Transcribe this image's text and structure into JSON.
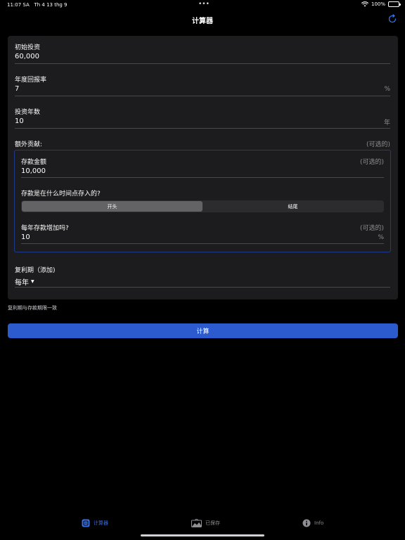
{
  "status": {
    "time": "11:07 SA",
    "date": "Th 4 13 thg 9",
    "dots": "•••",
    "battery": "100%"
  },
  "nav": {
    "title": "计算器",
    "refresh_icon": "refresh-icon"
  },
  "form": {
    "initial": {
      "label": "初始投资",
      "value": "60,000"
    },
    "rate": {
      "label": "年度回报率",
      "value": "7",
      "unit": "%"
    },
    "years": {
      "label": "投资年数",
      "value": "10",
      "unit": "年"
    },
    "extra": {
      "label": "额外贡献:",
      "optional": "(可选的)",
      "deposit": {
        "label": "存款金额",
        "optional": "(可选的)",
        "value": "10,000"
      },
      "timing": {
        "question": "存款是在什么时间点存入的?",
        "options": [
          "开头",
          "结尾"
        ],
        "selected": 0
      },
      "increase": {
        "label": "每年存款增加吗?",
        "optional": "(可选的)",
        "value": "10",
        "unit": "%"
      }
    },
    "compound": {
      "label": "复利期（添加)",
      "value": "每年"
    }
  },
  "note": "复利期与存款期限一致",
  "calculate_button": "计算",
  "tabs": [
    {
      "label": "计算器",
      "icon": "calculator-icon",
      "active": true
    },
    {
      "label": "已保存",
      "icon": "saved-chart-icon",
      "active": false
    },
    {
      "label": "Info",
      "icon": "info-icon",
      "active": false
    }
  ],
  "colors": {
    "accent": "#2c5bd0",
    "card": "#1c1c1e",
    "subbox_border": "#1f3a8a"
  }
}
